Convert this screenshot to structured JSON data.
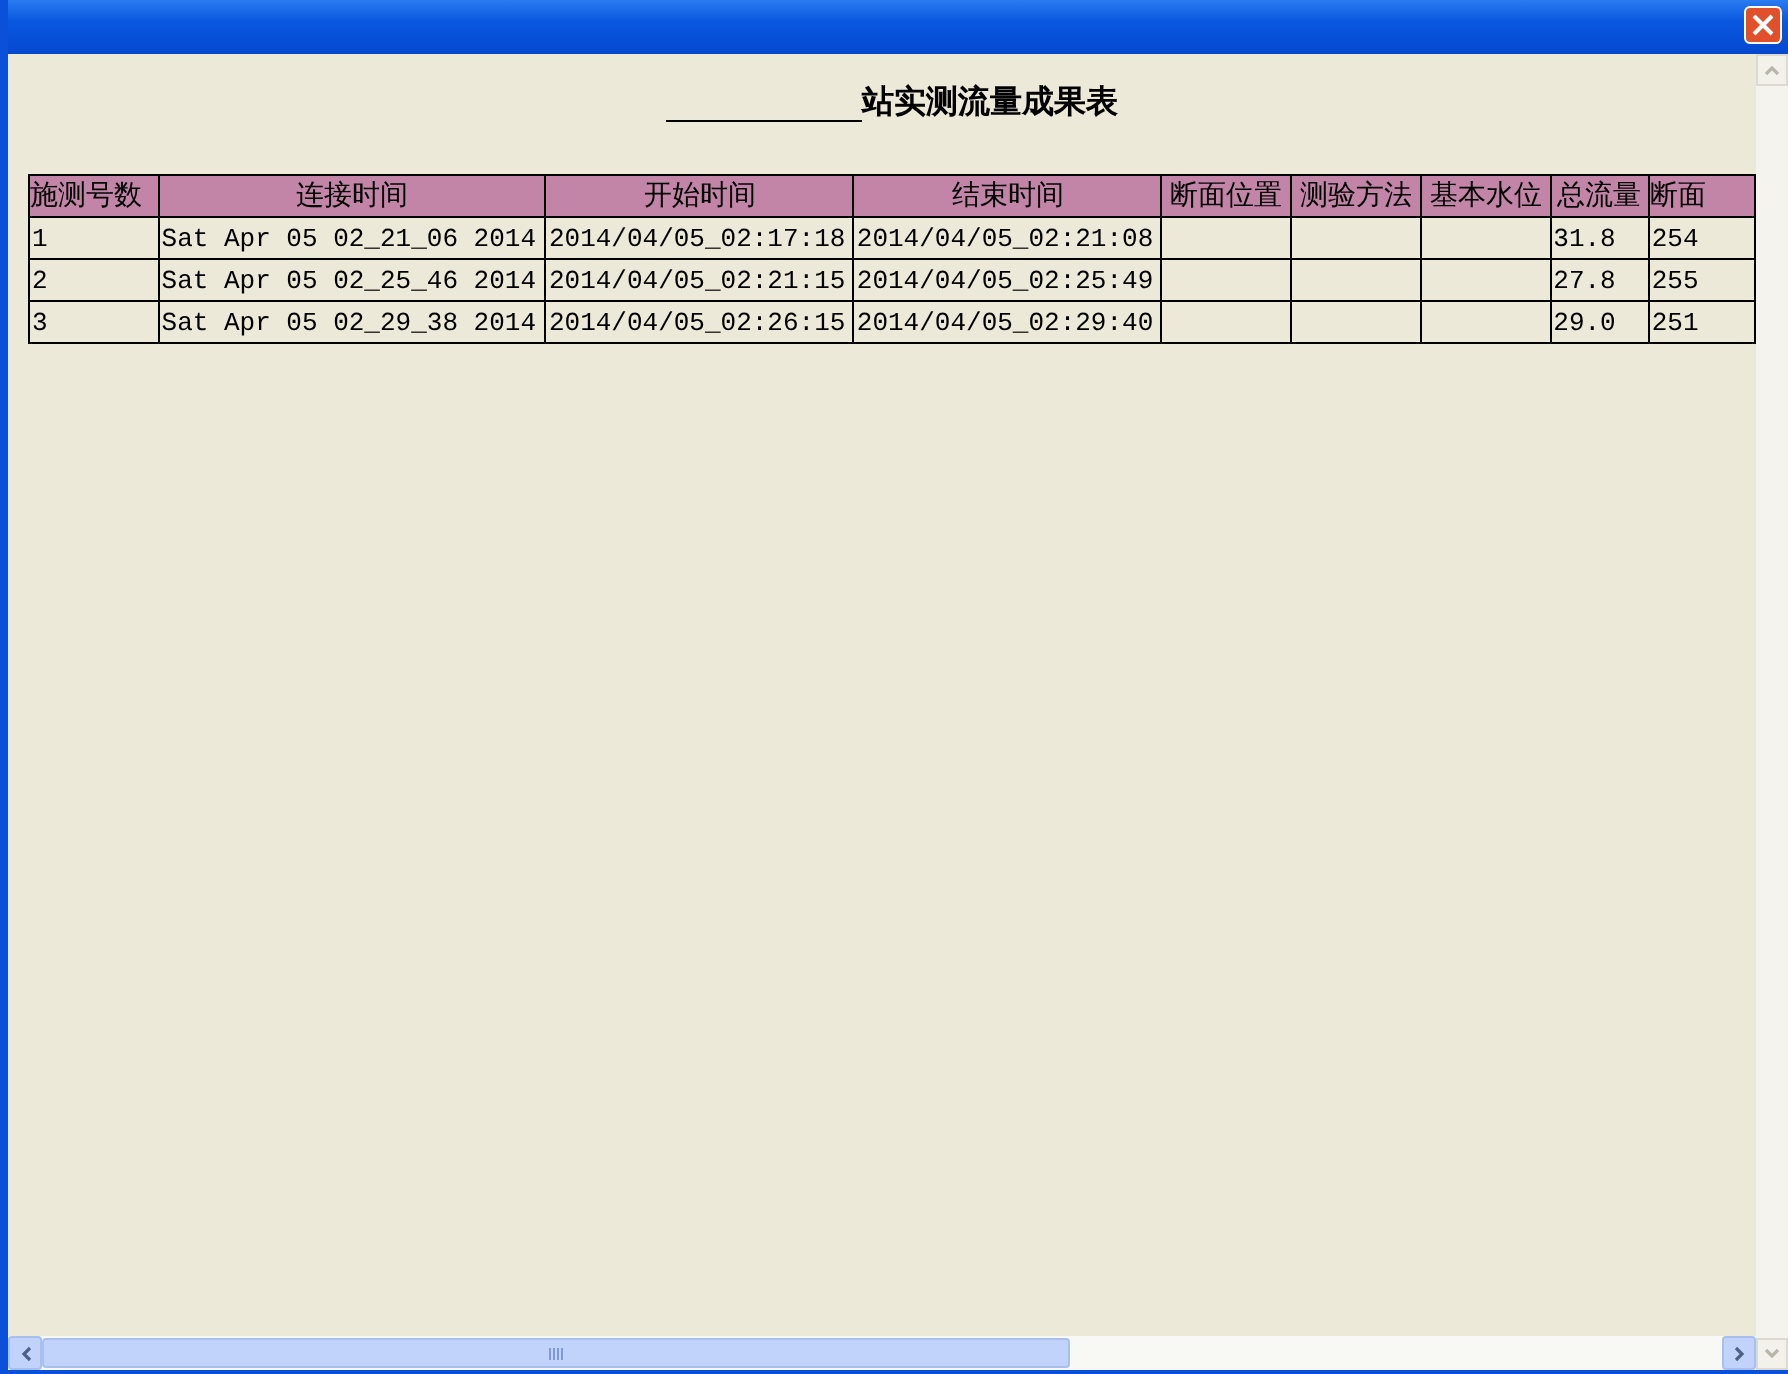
{
  "window": {
    "title_suffix": "站实测流量成果表"
  },
  "table": {
    "columns": [
      {
        "label": "施测号数"
      },
      {
        "label": "连接时间"
      },
      {
        "label": "开始时间"
      },
      {
        "label": "结束时间"
      },
      {
        "label": "断面位置"
      },
      {
        "label": "测验方法"
      },
      {
        "label": "基本水位"
      },
      {
        "label": "总流量"
      },
      {
        "label": "断面"
      }
    ],
    "rows": [
      [
        "1",
        "Sat Apr 05 02_21_06 2014",
        "2014/04/05_02:17:18",
        "2014/04/05_02:21:08",
        "",
        "",
        "",
        "31.8",
        "254"
      ],
      [
        "2",
        "Sat Apr 05 02_25_46 2014",
        "2014/04/05_02:21:15",
        "2014/04/05_02:25:49",
        "",
        "",
        "",
        "27.8",
        "255"
      ],
      [
        "3",
        "Sat Apr 05 02_29_38 2014",
        "2014/04/05_02:26:15",
        "2014/04/05_02:29:40",
        "",
        "",
        "",
        "29.0",
        "251"
      ]
    ]
  }
}
